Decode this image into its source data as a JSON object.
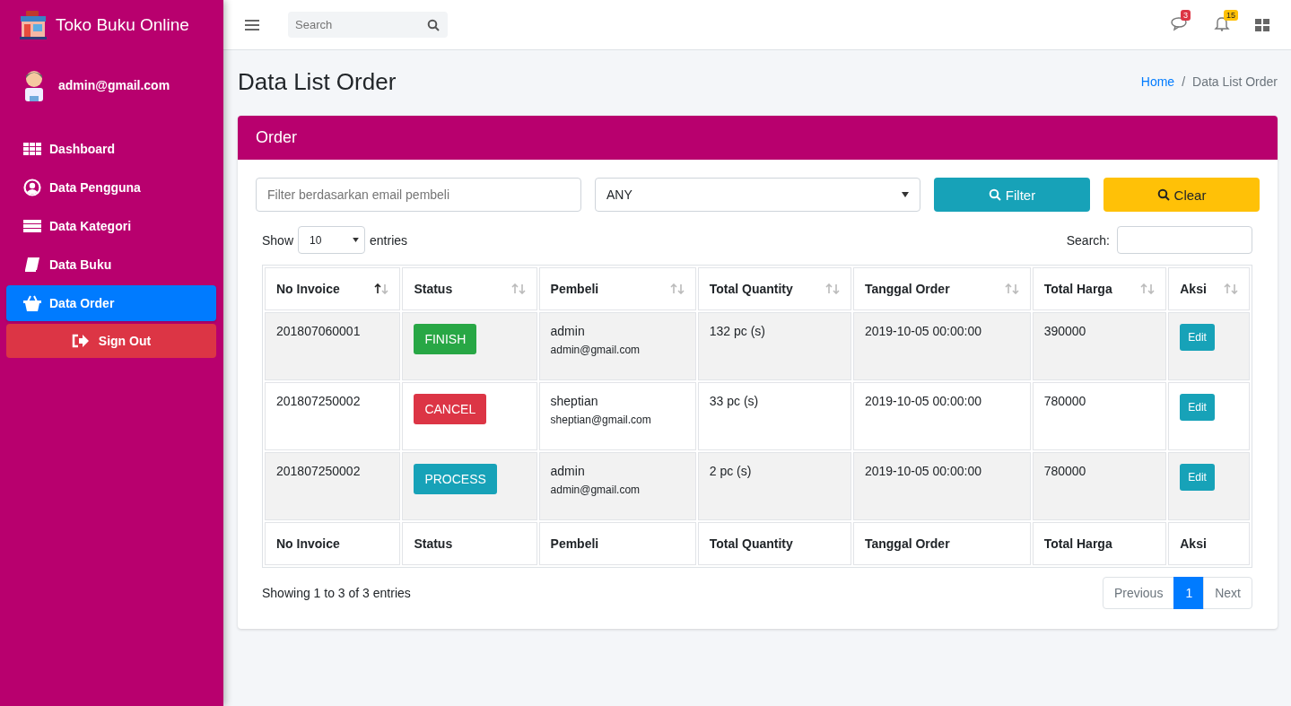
{
  "brand": {
    "title": "Toko Buku Online"
  },
  "user": {
    "email": "admin@gmail.com"
  },
  "sidebar": {
    "items": [
      {
        "label": "Dashboard",
        "kind": "dashboard",
        "selected": false
      },
      {
        "label": "Data Pengguna",
        "kind": "user",
        "selected": false
      },
      {
        "label": "Data Kategori",
        "kind": "list",
        "selected": false
      },
      {
        "label": "Data Buku",
        "kind": "book",
        "selected": false
      },
      {
        "label": "Data Order",
        "kind": "basket",
        "selected": true
      }
    ],
    "sign_out": "Sign Out"
  },
  "topbar": {
    "search": {
      "placeholder": "Search"
    },
    "messages_badge": "3",
    "notifications_badge": "15"
  },
  "page": {
    "title": "Data List Order",
    "breadcrumb_separator": "/",
    "breadcrumb": [
      {
        "label": "Home",
        "kind": "link"
      },
      {
        "label": "Data List Order",
        "kind": "current"
      }
    ]
  },
  "card": {
    "title": "Order",
    "filter": {
      "placeholder": "Filter berdasarkan email pembeli",
      "status_select": "ANY",
      "filter_button": "Filter",
      "clear_button": "Clear"
    },
    "length": {
      "show": "Show",
      "value": "10",
      "entries": "entries"
    },
    "search_label": "Search:",
    "table": {
      "columns": [
        {
          "label": "No Invoice",
          "kind": "sorted_asc"
        },
        {
          "label": "Status",
          "kind": "sortable"
        },
        {
          "label": "Pembeli",
          "kind": "sortable"
        },
        {
          "label": "Total Quantity",
          "kind": "sortable"
        },
        {
          "label": "Tanggal Order",
          "kind": "sortable"
        },
        {
          "label": "Total Harga",
          "kind": "sortable"
        },
        {
          "label": "Aksi",
          "kind": "sortable"
        }
      ],
      "rows": [
        {
          "invoice": "201807060001",
          "status": "FINISH",
          "kind": "finish",
          "buyer": "admin",
          "buyer_email": "admin@gmail.com",
          "quantity": "132 pc (s)",
          "date": "2019-10-05 00:00:00",
          "total": "390000",
          "action": "Edit"
        },
        {
          "invoice": "201807250002",
          "status": "CANCEL",
          "kind": "cancel",
          "buyer": "sheptian",
          "buyer_email": "sheptian@gmail.com",
          "quantity": "33 pc (s)",
          "date": "2019-10-05 00:00:00",
          "total": "780000",
          "action": "Edit"
        },
        {
          "invoice": "201807250002",
          "status": "PROCESS",
          "kind": "process",
          "buyer": "admin",
          "buyer_email": "admin@gmail.com",
          "quantity": "2 pc (s)",
          "date": "2019-10-05 00:00:00",
          "total": "780000",
          "action": "Edit"
        }
      ],
      "footer": [
        "No Invoice",
        "Status",
        "Pembeli",
        "Total Quantity",
        "Tanggal Order",
        "Total Harga",
        "Aksi"
      ]
    },
    "info": "Showing 1 to 3 of 3 entries",
    "pagination": [
      {
        "label": "Previous",
        "selected": false
      },
      {
        "label": "1",
        "selected": true
      },
      {
        "label": "Next",
        "selected": false
      }
    ]
  }
}
